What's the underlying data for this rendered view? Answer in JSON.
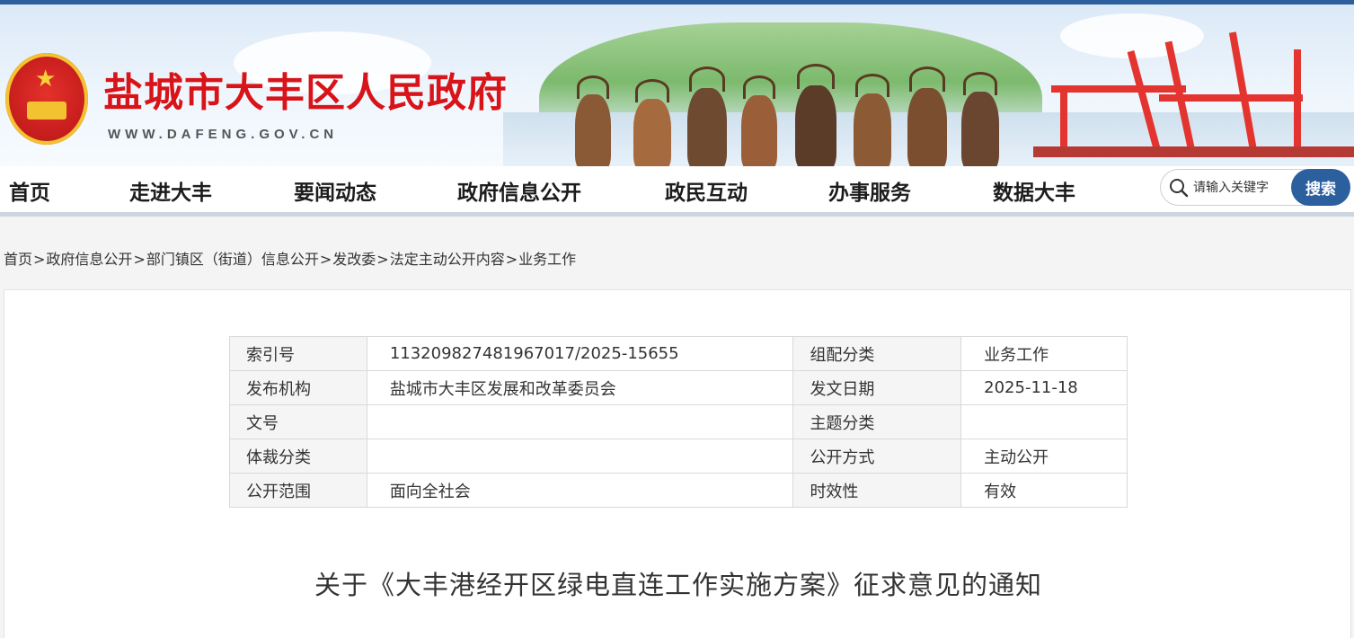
{
  "header": {
    "site_title": "盐城市大丰区人民政府",
    "site_url": "WWW.DAFENG.GOV.CN",
    "emblem_icon": "national-emblem-icon"
  },
  "nav": {
    "items": [
      {
        "label": "首页"
      },
      {
        "label": "走进大丰"
      },
      {
        "label": "要闻动态"
      },
      {
        "label": "政府信息公开"
      },
      {
        "label": "政民互动"
      },
      {
        "label": "办事服务"
      },
      {
        "label": "数据大丰"
      }
    ],
    "search_placeholder": "请输入关键字",
    "search_button": "搜索"
  },
  "breadcrumb": [
    "首页",
    "政府信息公开",
    "部门镇区（街道）信息公开",
    "发改委",
    "法定主动公开内容",
    "业务工作"
  ],
  "breadcrumb_sep": ">",
  "meta": {
    "rows": [
      {
        "l1": "索引号",
        "v1": "113209827481967017/2025-15655",
        "l2": "组配分类",
        "v2": "业务工作"
      },
      {
        "l1": "发布机构",
        "v1": "盐城市大丰区发展和改革委员会",
        "l2": "发文日期",
        "v2": "2025-11-18"
      },
      {
        "l1": "文号",
        "v1": "",
        "l2": "主题分类",
        "v2": ""
      },
      {
        "l1": "体裁分类",
        "v1": "",
        "l2": "公开方式",
        "v2": "主动公开"
      },
      {
        "l1": "公开范围",
        "v1": "面向全社会",
        "l2": "时效性",
        "v2": "有效"
      }
    ]
  },
  "document": {
    "title": "关于《大丰港经开区绿电直连工作实施方案》征求意见的通知"
  },
  "colors": {
    "brand_red": "#d7141a",
    "brand_blue": "#2c5f9e"
  }
}
